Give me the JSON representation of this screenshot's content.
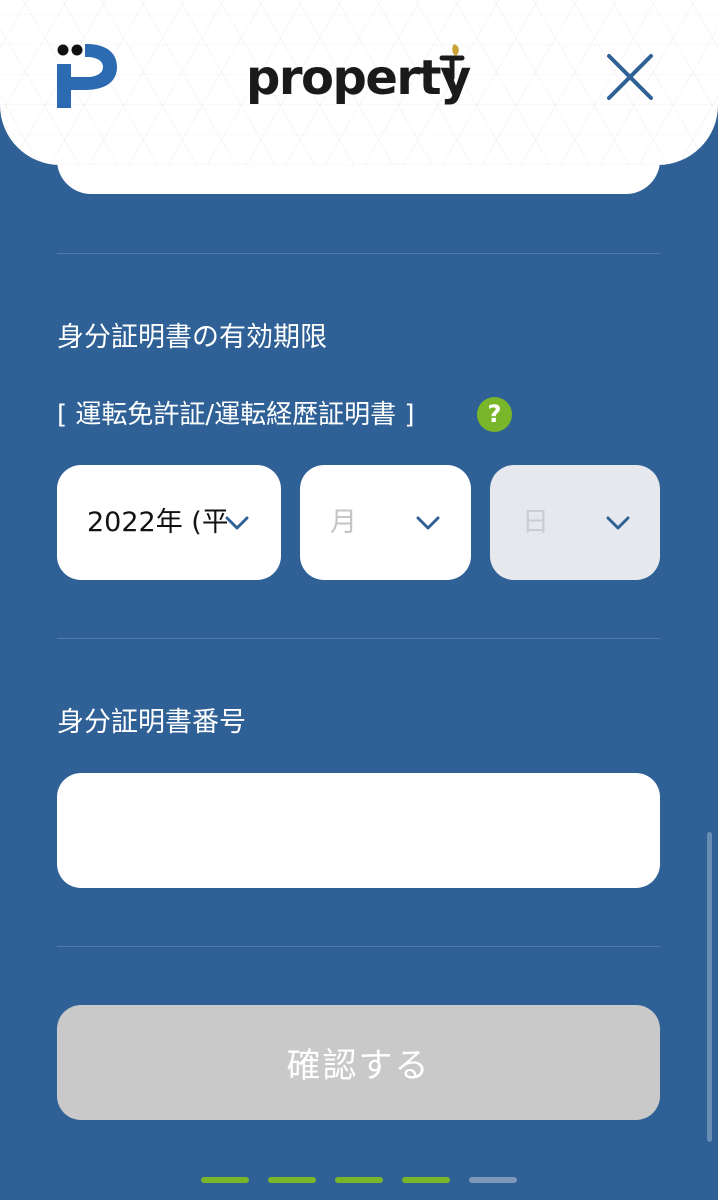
{
  "header": {
    "brand": "property",
    "logo_icon": "p-logo-icon",
    "close_icon": "close-icon"
  },
  "expiry": {
    "label": "身分証明書の有効期限",
    "sublabel": "[ 運転免許証/運転経歴証明書 ]",
    "help_text": "?",
    "year_value": "2022年 (平",
    "month_placeholder": "月",
    "day_placeholder": "日"
  },
  "id_number": {
    "label": "身分証明書番号",
    "value": ""
  },
  "actions": {
    "confirm_label": "確認する"
  },
  "progress": {
    "total_steps": 5,
    "completed_steps": 4
  },
  "colors": {
    "background": "#2f6196",
    "accent_green": "#7ab62a",
    "disabled_button": "#c9c9c9",
    "progress_inactive": "#7f97b8"
  }
}
